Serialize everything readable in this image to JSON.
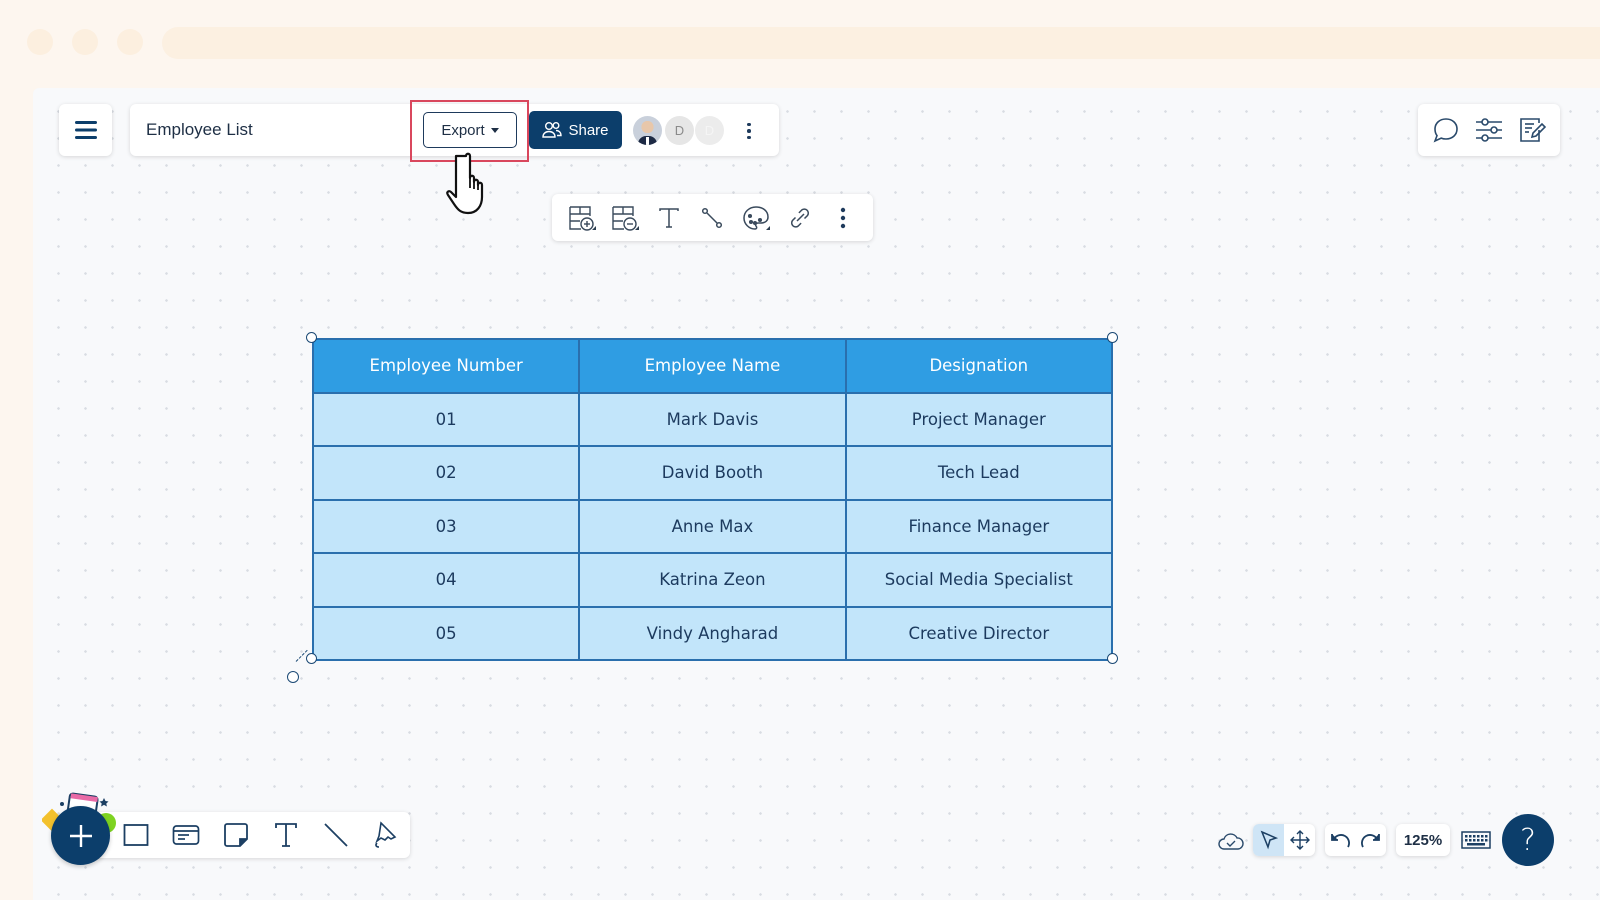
{
  "browser": {
    "tab_dots": 3
  },
  "header": {
    "menu_icon": "hamburger-icon",
    "document_title": "Employee List",
    "export_label": "Export",
    "share_label": "Share",
    "collaborators": [
      {
        "type": "photo",
        "initial": ""
      },
      {
        "type": "initial",
        "initial": "D"
      },
      {
        "type": "initial",
        "initial": "D"
      }
    ],
    "more_icon": "kebab-vertical-icon"
  },
  "right_panel": {
    "icons": [
      "comment-icon",
      "sliders-icon",
      "edit-notes-icon"
    ]
  },
  "table_toolbar": {
    "icons": [
      "insert-table-row-icon",
      "remove-table-row-icon",
      "text-icon",
      "connector-icon",
      "palette-icon",
      "link-icon",
      "more-icon"
    ]
  },
  "table": {
    "columns": [
      "Employee Number",
      "Employee Name",
      "Designation"
    ],
    "rows": [
      [
        "01",
        "Mark Davis",
        "Project Manager"
      ],
      [
        "02",
        "David Booth",
        "Tech Lead"
      ],
      [
        "03",
        "Anne Max",
        "Finance Manager"
      ],
      [
        "04",
        "Katrina Zeon",
        "Social Media Specialist"
      ],
      [
        "05",
        "Vindy Angharad",
        "Creative Director"
      ]
    ],
    "colors": {
      "header_bg": "#2f9de3",
      "cell_bg": "#c2e5fa",
      "border": "#2a6fad"
    }
  },
  "bottom_toolbar": {
    "add_icon": "plus-icon",
    "tools": [
      "rectangle-icon",
      "card-icon",
      "sticky-note-icon",
      "text-icon",
      "line-icon",
      "pen-icon"
    ]
  },
  "status_bar": {
    "save_icon": "cloud-check-icon",
    "modes": [
      "select-pointer-icon",
      "pan-move-icon"
    ],
    "active_mode": "select-pointer-icon",
    "undo_icon": "undo-icon",
    "redo_icon": "redo-icon",
    "zoom_level": "125%",
    "keyboard_icon": "keyboard-icon",
    "help_label": "?"
  },
  "colors": {
    "brand": "#0c3e6b",
    "highlight": "#d9475d"
  }
}
